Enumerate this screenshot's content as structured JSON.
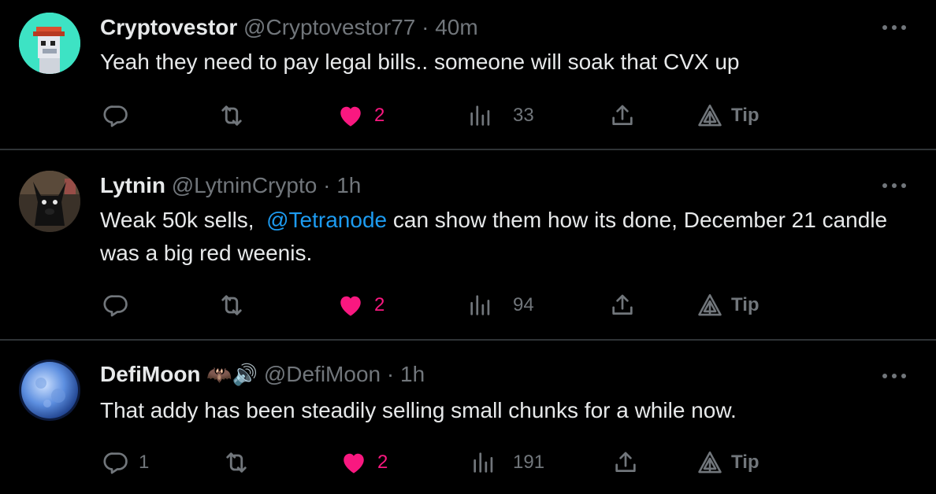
{
  "colors": {
    "background": "#000000",
    "text": "#e7e9ea",
    "muted": "#71767b",
    "like": "#f91880",
    "link": "#1d9bf0",
    "divider": "#2f3336"
  },
  "tweets": [
    {
      "name": "Cryptovestor",
      "handle": "@Cryptovestor77",
      "separator": "·",
      "time": "40m",
      "text_parts": [
        "Yeah they need to pay legal bills.. someone will soak that CVX up"
      ],
      "replies": "",
      "likes": "2",
      "views": "33",
      "tip": "Tip",
      "avatar_icon": "pixel-art-avatar-icon"
    },
    {
      "name": "Lytnin",
      "handle": "@LytninCrypto",
      "separator": "·",
      "time": "1h",
      "text_before": "Weak 50k sells,  ",
      "mention": "@Tetranode",
      "text_after": " can show them how its done, December 21 candle was a big red weenis.",
      "replies": "",
      "likes": "2",
      "views": "94",
      "tip": "Tip",
      "avatar_icon": "dark-creature-avatar-icon"
    },
    {
      "name": "DefiMoon",
      "name_emoji": "🦇🔊",
      "handle": "@DefiMoon",
      "separator": "·",
      "time": "1h",
      "text_parts": [
        "That addy has been steadily selling small chunks for a while now."
      ],
      "replies": "1",
      "likes": "2",
      "views": "191",
      "tip": "Tip",
      "avatar_icon": "moon-avatar-icon"
    }
  ]
}
